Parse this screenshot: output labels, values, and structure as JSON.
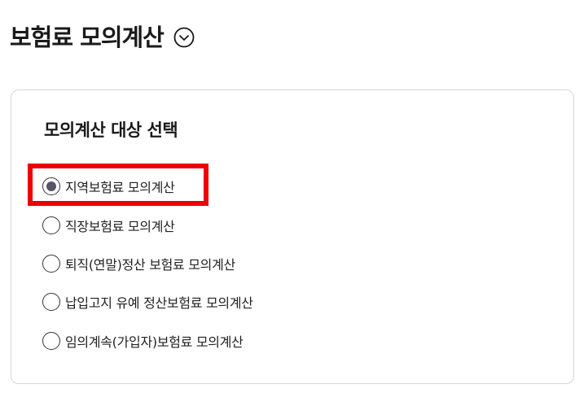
{
  "header": {
    "title": "보험료 모의계산",
    "toggle_icon": "chevron-down-circle-icon"
  },
  "target_section": {
    "title": "모의계산 대상 선택",
    "selected_index": 0,
    "options": [
      {
        "label": "지역보험료 모의계산",
        "selected": true
      },
      {
        "label": "직장보험료 모의계산",
        "selected": false
      },
      {
        "label": "퇴직(연말)정산 보험료 모의계산",
        "selected": false
      },
      {
        "label": "납입고지 유예 정산보험료 모의계산",
        "selected": false
      },
      {
        "label": "임의계속(가입자)보험료 모의계산",
        "selected": false
      }
    ]
  },
  "colors": {
    "highlight": "#ee0000",
    "card_border": "#d6d6d6",
    "radio_selected": "#555566"
  }
}
